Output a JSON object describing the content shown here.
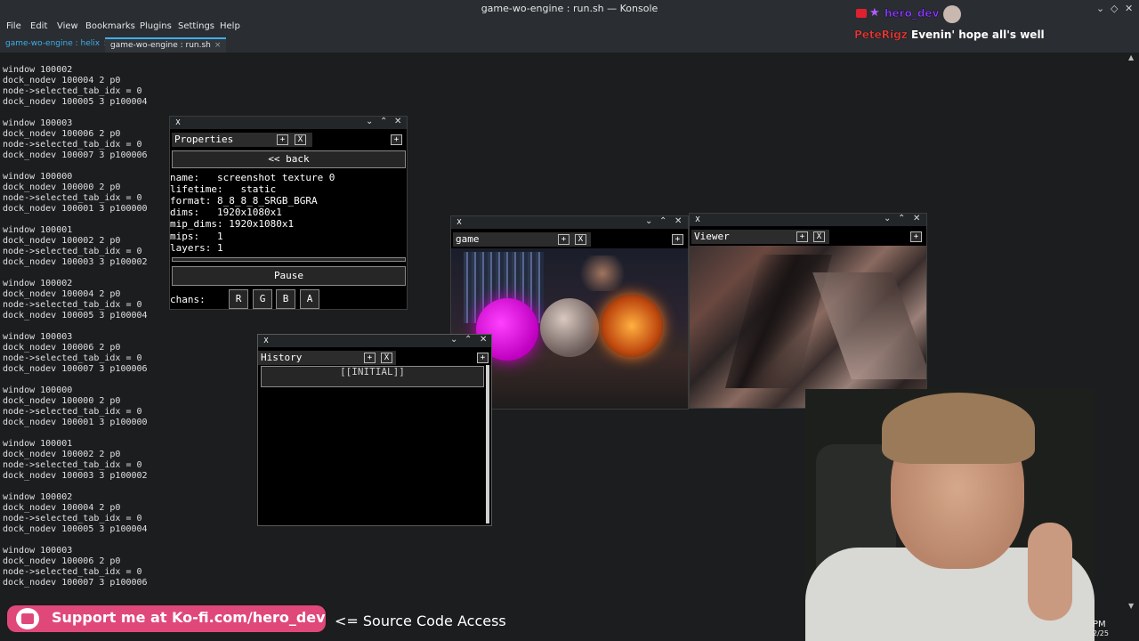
{
  "window": {
    "title": "game-wo-engine : run.sh — Konsole"
  },
  "menu": [
    "File",
    "Edit",
    "View",
    "Bookmarks",
    "Plugins",
    "Settings",
    "Help"
  ],
  "tabs": [
    {
      "label": "game-wo-engine : helix",
      "close": "×"
    },
    {
      "label": "game-wo-engine : run.sh",
      "close": "×"
    }
  ],
  "log_blocks": [
    [
      "window 100002",
      "dock_nodev 100004 2 p0",
      "node->selected_tab_idx = 0",
      "dock_nodev 100005 3 p100004"
    ],
    [
      "window 100003",
      "dock_nodev 100006 2 p0",
      "node->selected_tab_idx = 0",
      "dock_nodev 100007 3 p100006"
    ],
    [
      "window 100000",
      "dock_nodev 100000 2 p0",
      "node->selected_tab_idx = 0",
      "dock_nodev 100001 3 p100000"
    ],
    [
      "window 100001",
      "dock_nodev 100002 2 p0",
      "node->selected_tab_idx = 0",
      "dock_nodev 100003 3 p100002"
    ],
    [
      "window 100002",
      "dock_nodev 100004 2 p0",
      "node->selected_tab_idx = 0",
      "dock_nodev 100005 3 p100004"
    ],
    [
      "window 100003",
      "dock_nodev 100006 2 p0",
      "node->selected_tab_idx = 0",
      "dock_nodev 100007 3 p100006"
    ],
    [
      "window 100000",
      "dock_nodev 100000 2 p0",
      "node->selected_tab_idx = 0",
      "dock_nodev 100001 3 p100000"
    ],
    [
      "window 100001",
      "dock_nodev 100002 2 p0",
      "node->selected_tab_idx = 0",
      "dock_nodev 100003 3 p100002"
    ],
    [
      "window 100002",
      "dock_nodev 100004 2 p0",
      "node->selected_tab_idx = 0",
      "dock_nodev 100005 3 p100004"
    ],
    [
      "window 100003",
      "dock_nodev 100006 2 p0",
      "node->selected_tab_idx = 0",
      "dock_nodev 100007 3 p100006"
    ]
  ],
  "properties": {
    "tab_label": "Properties",
    "back_label": "<< back",
    "rows": [
      "name:   screenshot texture 0",
      "lifetime:   static",
      "format: 8_8_8_8_SRGB_BGRA",
      "dims:   1920x1080x1",
      "mip_dims: 1920x1080x1",
      "mips:   1",
      "layers: 1"
    ],
    "pause_label": "Pause",
    "chans_label": "chans:",
    "channels": [
      "R",
      "G",
      "B",
      "A"
    ]
  },
  "game": {
    "tab_label": "game"
  },
  "viewer": {
    "tab_label": "Viewer"
  },
  "history": {
    "tab_label": "History",
    "entry": "[[INITIAL]]"
  },
  "panel_buttons": {
    "plus": "+",
    "close": "X"
  },
  "chat": {
    "user": "hero_dev",
    "sender": "PeteRigz",
    "message": "Evenin' hope all's well"
  },
  "overlay": {
    "kofi": "Support me at Ko-fi.com/hero_dev",
    "source": "<= Source Code Access"
  },
  "clock": {
    "time": "PM",
    "date": "2/25"
  }
}
